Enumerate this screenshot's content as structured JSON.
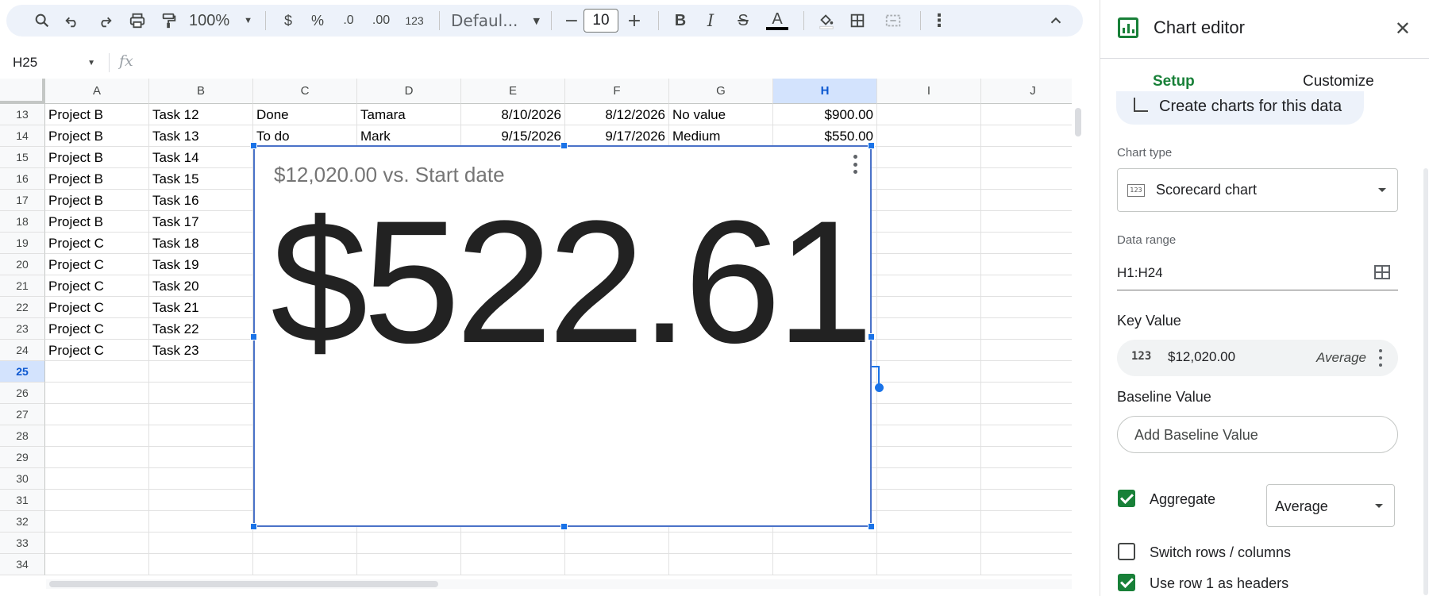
{
  "toolbar": {
    "zoom": "100%",
    "currency_label": "$",
    "percent_label": "%",
    "decrease_decimal_label": ".0",
    "increase_decimal_label": ".00",
    "number_format_label": "123",
    "font": "Defaul...",
    "font_size": "10",
    "bold_label": "B",
    "italic_label": "I",
    "strike_label": "S",
    "text_color_label": "A"
  },
  "formula_bar": {
    "name_box": "H25",
    "fx_label": "fx"
  },
  "columns": [
    "A",
    "B",
    "C",
    "D",
    "E",
    "F",
    "G",
    "H",
    "I",
    "J"
  ],
  "row_numbers": [
    "13",
    "14",
    "15",
    "16",
    "17",
    "18",
    "19",
    "20",
    "21",
    "22",
    "23",
    "24",
    "25",
    "26",
    "27",
    "28",
    "29",
    "30",
    "31",
    "32",
    "33",
    "34"
  ],
  "rows": [
    [
      "Project B",
      "Task 12",
      "Done",
      "Tamara",
      "8/10/2026",
      "8/12/2026",
      "No value",
      "$900.00"
    ],
    [
      "Project B",
      "Task 13",
      "To do",
      "Mark",
      "9/15/2026",
      "9/17/2026",
      "Medium",
      "$550.00"
    ],
    [
      "Project B",
      "Task 14"
    ],
    [
      "Project B",
      "Task 15"
    ],
    [
      "Project B",
      "Task 16"
    ],
    [
      "Project B",
      "Task 17"
    ],
    [
      "Project C",
      "Task 18"
    ],
    [
      "Project C",
      "Task 19"
    ],
    [
      "Project C",
      "Task 20"
    ],
    [
      "Project C",
      "Task 21"
    ],
    [
      "Project C",
      "Task 22"
    ],
    [
      "Project C",
      "Task 23"
    ]
  ],
  "chart": {
    "subtitle": "$12,020.00 vs. Start date",
    "value": "$522.61"
  },
  "panel": {
    "title": "Chart editor",
    "tabs": [
      "Setup",
      "Customize"
    ],
    "create_chip": "Create charts for this data",
    "chart_type_label": "Chart type",
    "chart_type": "Scorecard chart",
    "chart_type_icon_text": "123",
    "data_range_label": "Data range",
    "data_range": "H1:H24",
    "key_value_heading": "Key Value",
    "key_value_icon_text": "123",
    "key_value": "$12,020.00",
    "key_value_agg": "Average",
    "baseline_heading": "Baseline Value",
    "add_baseline": "Add Baseline Value",
    "aggregate_label": "Aggregate",
    "aggregate_checked": true,
    "aggregate_select": "Average",
    "switch_label": "Switch rows / columns",
    "switch_checked": false,
    "headers_label": "Use row 1 as headers",
    "headers_checked": true
  }
}
